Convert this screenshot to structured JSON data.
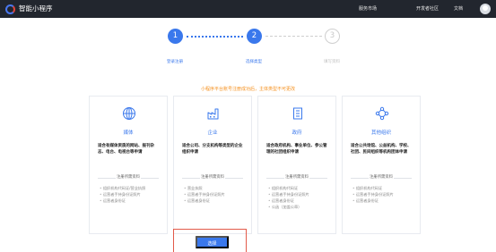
{
  "header": {
    "app_title": "智能小程序",
    "nav": [
      "服务市场",
      "开发者社区",
      "文档"
    ]
  },
  "steps": [
    {
      "number": "1",
      "label": "登录注册",
      "state": "done"
    },
    {
      "number": "2",
      "label": "选择类型",
      "state": "active"
    },
    {
      "number": "3",
      "label": "填写资料",
      "state": "todo"
    }
  ],
  "notice": "小程序平台账号注册成功后，主体类型不可更改",
  "cards": [
    {
      "icon": "globe-icon",
      "title": "媒体",
      "desc": "适合有媒体资质的网站、报刊杂志、电台、电视台等申请",
      "req_heading": "注册所需资料",
      "requirements": [
        "组织机构代码证/营业执照",
        "运营者手持身份证照片",
        "运营者身份证"
      ]
    },
    {
      "icon": "factory-icon",
      "title": "企业",
      "desc": "适合公司、分支机构等类型的企业组织申请",
      "req_heading": "注册所需资料",
      "requirements": [
        "营业执照",
        "运营者手持身份证照片",
        "运营者身份证"
      ]
    },
    {
      "icon": "building-icon",
      "title": "政府",
      "desc": "适合政府机构、事业单位、参公管理的社团组织申请",
      "req_heading": "注册所需资料",
      "requirements": [
        "组织机构代码证",
        "运营者手持身份证照片",
        "运营者身份证",
        "公函（加盖公章）"
      ]
    },
    {
      "icon": "network-icon",
      "title": "其他组织",
      "desc": "适合公共场馆、公益机构、学校、社团、民间组织等机构团体申请",
      "req_heading": "注册所需资料",
      "requirements": [
        "组织机构代码证",
        "运营者手持身份证照片",
        "运营者身份证"
      ]
    }
  ],
  "select_button": "选择",
  "colors": {
    "accent": "#3a78ec",
    "notice": "#f5901d",
    "highlight_frame": "#e25a4a",
    "topbar": "#22262e"
  }
}
